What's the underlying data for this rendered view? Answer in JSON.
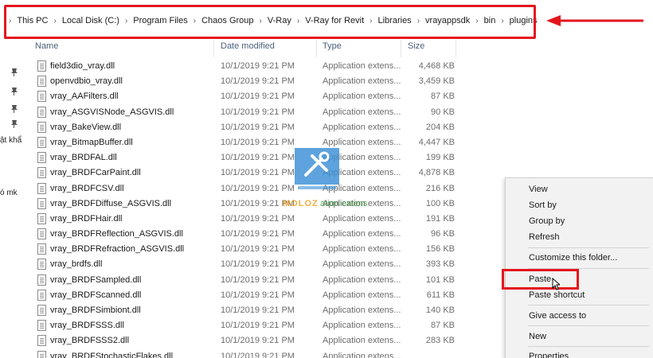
{
  "address_bar": {
    "crumbs": [
      "This PC",
      "Local Disk (C:)",
      "Program Files",
      "Chaos Group",
      "V-Ray",
      "V-Ray for Revit",
      "Libraries",
      "vrayappsdk",
      "bin",
      "plugins"
    ]
  },
  "nav": {
    "partial_labels": [
      "ật khẩ",
      "ó mk"
    ]
  },
  "columns": {
    "name": "Name",
    "date": "Date modified",
    "type": "Type",
    "size": "Size"
  },
  "files": [
    {
      "name": "field3dio_vray.dll",
      "date": "10/1/2019 9:21 PM",
      "type": "Application extens...",
      "size": "4,468 KB"
    },
    {
      "name": "openvdbio_vray.dll",
      "date": "10/1/2019 9:21 PM",
      "type": "Application extens...",
      "size": "3,459 KB"
    },
    {
      "name": "vray_AAFilters.dll",
      "date": "10/1/2019 9:21 PM",
      "type": "Application extens...",
      "size": "87 KB"
    },
    {
      "name": "vray_ASGVISNode_ASGVIS.dll",
      "date": "10/1/2019 9:21 PM",
      "type": "Application extens...",
      "size": "90 KB"
    },
    {
      "name": "vray_BakeView.dll",
      "date": "10/1/2019 9:21 PM",
      "type": "Application extens...",
      "size": "204 KB"
    },
    {
      "name": "vray_BitmapBuffer.dll",
      "date": "10/1/2019 9:21 PM",
      "type": "Application extens...",
      "size": "4,447 KB"
    },
    {
      "name": "vray_BRDFAL.dll",
      "date": "10/1/2019 9:21 PM",
      "type": "Application extens...",
      "size": "199 KB"
    },
    {
      "name": "vray_BRDFCarPaint.dll",
      "date": "10/1/2019 9:21 PM",
      "type": "Application extens...",
      "size": "4,878 KB"
    },
    {
      "name": "vray_BRDFCSV.dll",
      "date": "10/1/2019 9:21 PM",
      "type": "Application extens...",
      "size": "216 KB"
    },
    {
      "name": "vray_BRDFDiffuse_ASGVIS.dll",
      "date": "10/1/2019 9:21 PM",
      "type": "Application extens...",
      "size": "100 KB"
    },
    {
      "name": "vray_BRDFHair.dll",
      "date": "10/1/2019 9:21 PM",
      "type": "Application extens...",
      "size": "191 KB"
    },
    {
      "name": "vray_BRDFReflection_ASGVIS.dll",
      "date": "10/1/2019 9:21 PM",
      "type": "Application extens...",
      "size": "96 KB"
    },
    {
      "name": "vray_BRDFRefraction_ASGVIS.dll",
      "date": "10/1/2019 9:21 PM",
      "type": "Application extens...",
      "size": "156 KB"
    },
    {
      "name": "vray_brdfs.dll",
      "date": "10/1/2019 9:21 PM",
      "type": "Application extens...",
      "size": "393 KB"
    },
    {
      "name": "vray_BRDFSampled.dll",
      "date": "10/1/2019 9:21 PM",
      "type": "Application extens...",
      "size": "101 KB"
    },
    {
      "name": "vray_BRDFScanned.dll",
      "date": "10/1/2019 9:21 PM",
      "type": "Application extens...",
      "size": "611 KB"
    },
    {
      "name": "vray_BRDFSimbiont.dll",
      "date": "10/1/2019 9:21 PM",
      "type": "Application extens...",
      "size": "140 KB"
    },
    {
      "name": "vray_BRDFSSS.dll",
      "date": "10/1/2019 9:21 PM",
      "type": "Application extens...",
      "size": "87 KB"
    },
    {
      "name": "vray_BRDFSSS2.dll",
      "date": "10/1/2019 9:21 PM",
      "type": "Application extens...",
      "size": "283 KB"
    },
    {
      "name": "vray_BRDFStochasticFlakes.dll",
      "date": "10/1/2019 9:21 PM",
      "type": "Application extens...",
      "size": ""
    }
  ],
  "watermark": {
    "text": "MOLOZ",
    "sub": "ation extens"
  },
  "context_menu": {
    "view": "View",
    "sort_by": "Sort by",
    "group_by": "Group by",
    "refresh": "Refresh",
    "customize": "Customize this folder...",
    "paste": "Paste",
    "paste_shortcut": "Paste shortcut",
    "give_access": "Give access to",
    "new": "New",
    "properties": "Properties"
  },
  "colors": {
    "annotation_red": "#e4161d",
    "header_text": "#4c607a",
    "menu_bg": "#f2f2f2"
  }
}
